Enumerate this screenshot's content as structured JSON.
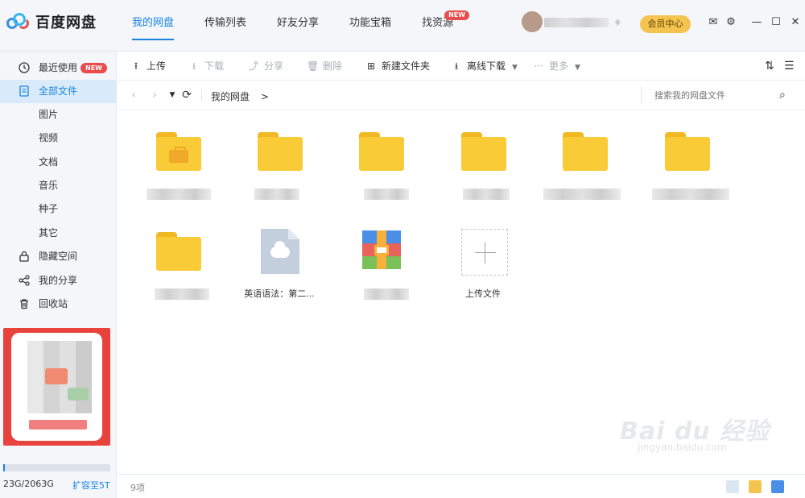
{
  "app": {
    "logo_text": "百度网盘"
  },
  "topnav": {
    "tabs": [
      {
        "label": "我的网盘"
      },
      {
        "label": "传输列表"
      },
      {
        "label": "好友分享"
      },
      {
        "label": "功能宝箱"
      },
      {
        "label": "找资源",
        "badge": "NEW"
      }
    ]
  },
  "user": {
    "member_center": "会员中心"
  },
  "sidebar": {
    "items": [
      {
        "label": "最近使用",
        "badge": "NEW"
      },
      {
        "label": "全部文件"
      },
      {
        "label": "图片"
      },
      {
        "label": "视频"
      },
      {
        "label": "文档"
      },
      {
        "label": "音乐"
      },
      {
        "label": "种子"
      },
      {
        "label": "其它"
      },
      {
        "label": "隐藏空间"
      },
      {
        "label": "我的分享"
      },
      {
        "label": "回收站"
      }
    ],
    "storage": {
      "used_text": "23G/2063G",
      "expand": "扩容至5T",
      "used_fraction": 0.011
    }
  },
  "toolbar": {
    "upload": "上传",
    "download": "下载",
    "share": "分享",
    "delete": "删除",
    "new_folder": "新建文件夹",
    "offline_download": "离线下载",
    "more": "更多"
  },
  "addressbar": {
    "breadcrumb": "我的网盘",
    "separator": ">",
    "search_placeholder": "搜索我的网盘文件"
  },
  "files": {
    "items": [
      {
        "name": "英语语法：第二..."
      },
      {
        "name": "上传文件"
      }
    ]
  },
  "statusbar": {
    "count": "9项"
  },
  "watermark": {
    "text": "Bai  du 经验",
    "url": "jingyan.baidu.com"
  },
  "colors": {
    "accent": "#1a82e2",
    "folder": "#f9cb36",
    "badge": "#e84c4c",
    "member": "#f5c450"
  }
}
